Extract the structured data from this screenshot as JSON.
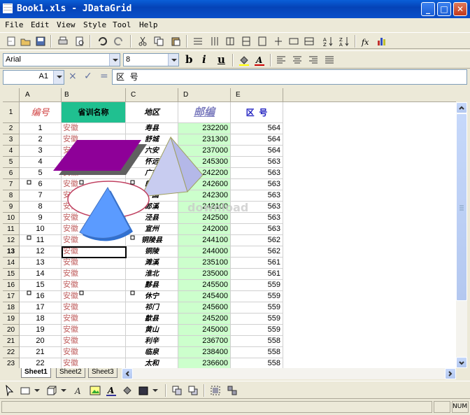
{
  "window": {
    "title": "Book1.xls - JDataGrid"
  },
  "menu": [
    "File",
    "Edit",
    "View",
    "Style",
    "Tool",
    "Help"
  ],
  "font_toolbar": {
    "font_name": "Arial",
    "font_size": "8",
    "bold": "b",
    "italic": "i",
    "underline": "u"
  },
  "formula": {
    "cell_ref": "A1",
    "content": "区  号",
    "cancel": "×",
    "accept": "✓",
    "equals": "="
  },
  "columns": [
    "A",
    "B",
    "C",
    "D",
    "E"
  ],
  "header_row": {
    "a": "编号",
    "b": "省训名称",
    "c": "地区",
    "d": "邮编",
    "e": "区  号"
  },
  "rows": [
    {
      "n": "2",
      "a": "1",
      "b": "安徽",
      "c": "寿县",
      "d": "232200",
      "e": "564"
    },
    {
      "n": "3",
      "a": "2",
      "b": "安徽",
      "c": "舒城",
      "d": "231300",
      "e": "564"
    },
    {
      "n": "4",
      "a": "3",
      "b": "安徽",
      "c": "六安",
      "d": "237000",
      "e": "564"
    },
    {
      "n": "5",
      "a": "4",
      "b": "安徽",
      "c": "怀远",
      "d": "245300",
      "e": "563"
    },
    {
      "n": "6",
      "a": "5",
      "b": "安徽",
      "c": "广德",
      "d": "242200",
      "e": "563"
    },
    {
      "n": "7",
      "a": "6",
      "b": "安徽",
      "c": "郎溪",
      "d": "242600",
      "e": "563"
    },
    {
      "n": "8",
      "a": "7",
      "b": "安徽",
      "c": "宁国",
      "d": "242300",
      "e": "563"
    },
    {
      "n": "9",
      "a": "8",
      "b": "安徽",
      "c": "郎溪",
      "d": "242100",
      "e": "563"
    },
    {
      "n": "10",
      "a": "9",
      "b": "安徽",
      "c": "泾县",
      "d": "242500",
      "e": "563"
    },
    {
      "n": "11",
      "a": "10",
      "b": "安徽",
      "c": "宣州",
      "d": "242000",
      "e": "563"
    },
    {
      "n": "12",
      "a": "11",
      "b": "安徽",
      "c": "铜陵县",
      "d": "244100",
      "e": "562"
    },
    {
      "n": "13",
      "a": "12",
      "b": "安徽",
      "c": "铜陵",
      "d": "244000",
      "e": "562"
    },
    {
      "n": "14",
      "a": "13",
      "b": "安徽",
      "c": "濉溪",
      "d": "235100",
      "e": "561"
    },
    {
      "n": "15",
      "a": "14",
      "b": "安徽",
      "c": "淮北",
      "d": "235000",
      "e": "561"
    },
    {
      "n": "16",
      "a": "15",
      "b": "安徽",
      "c": "黟县",
      "d": "245500",
      "e": "559"
    },
    {
      "n": "17",
      "a": "16",
      "b": "安徽",
      "c": "休宁",
      "d": "245400",
      "e": "559"
    },
    {
      "n": "18",
      "a": "17",
      "b": "安徽",
      "c": "祁门",
      "d": "245600",
      "e": "559"
    },
    {
      "n": "19",
      "a": "18",
      "b": "安徽",
      "c": "歙县",
      "d": "245200",
      "e": "559"
    },
    {
      "n": "20",
      "a": "19",
      "b": "安徽",
      "c": "黄山",
      "d": "245000",
      "e": "559"
    },
    {
      "n": "21",
      "a": "20",
      "b": "安徽",
      "c": "利辛",
      "d": "236700",
      "e": "558"
    },
    {
      "n": "22",
      "a": "21",
      "b": "安徽",
      "c": "临泉",
      "d": "238400",
      "e": "558"
    },
    {
      "n": "23",
      "a": "22",
      "b": "安徽",
      "c": "太和",
      "d": "236600",
      "e": "558"
    }
  ],
  "watermark": "download",
  "sheets": [
    "Sheet1",
    "Sheet2",
    "Sheet3"
  ],
  "status": {
    "num": "NUM"
  },
  "colors": {
    "header_b_bg": "#20c090",
    "col_d_bg": "#ccffcc",
    "red_text": "#c06060",
    "parallelogram": "#8e0098",
    "pyramid": "#c8ccf0",
    "pie": "#5b9bff"
  }
}
